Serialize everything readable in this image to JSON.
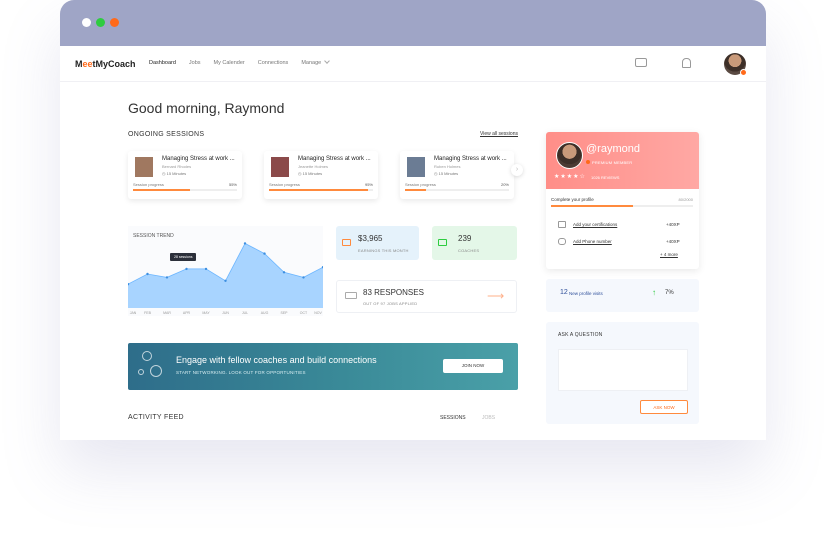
{
  "app": {
    "logo_pre": "M",
    "logo_accent": "ee",
    "logo_post": "tMyCoach"
  },
  "nav": {
    "items": [
      "Dashboard",
      "Jobs",
      "My Calender",
      "Connections",
      "Manage"
    ]
  },
  "greeting": "Good morning, Raymond",
  "sessions": {
    "title": "ONGOING SESSIONS",
    "view_all": "View all sessions",
    "cards": [
      {
        "title": "Managing Stress at work ...",
        "coach": "Bernard Rhodes",
        "time": "15 Minutes",
        "progress_label": "Session progress",
        "progress": "55%",
        "progress_value": 0.55
      },
      {
        "title": "Managing Stress at work ...",
        "coach": "Jeanette Holmes",
        "time": "15 Minutes",
        "progress_label": "Session progress",
        "progress": "95%",
        "progress_value": 0.95
      },
      {
        "title": "Managing Stress at work ...",
        "coach": "Ruben Holmes",
        "time": "15 Minutes",
        "progress_label": "Session progress",
        "progress": "20%",
        "progress_value": 0.2
      }
    ]
  },
  "trend": {
    "title": "SESSION TREND",
    "tooltip": "28 sessions",
    "months": [
      "JAN",
      "FEB",
      "MAR",
      "APR",
      "MAY",
      "JUN",
      "JUL",
      "AUG",
      "SEP",
      "OCT",
      "NOV"
    ],
    "values": [
      14,
      20,
      18,
      23,
      23,
      16,
      38,
      32,
      21,
      18,
      24
    ]
  },
  "stats": {
    "earnings": {
      "value": "$3,965",
      "label": "EARNINGS THIS MONTH"
    },
    "coaches": {
      "value": "239",
      "label": "COACHES"
    },
    "responses": {
      "value": "83 RESPONSES",
      "label": "OUT OF 97 JOBS APPLIED"
    }
  },
  "banner": {
    "title": "Engage with fellow coaches and build connections",
    "subtitle": "START NETWORKING. LOOK OUT FOR OPPORTUNITIES",
    "button": "JOIN NOW"
  },
  "feed": {
    "title": "ACTIVITY FEED",
    "tabs": [
      "SESSIONS",
      "JOBS"
    ]
  },
  "profile": {
    "handle": "@raymond",
    "tier": "PREMIUM MEMBER",
    "stars": "★★★★☆",
    "reviews": "1026 REVIEWS",
    "complete_label": "Complete your profile",
    "complete_value": "80/2000",
    "complete_fraction": 0.58,
    "tasks": [
      {
        "label": "Add your certifications",
        "xp": "+40XP"
      },
      {
        "label": "Add Phone number",
        "xp": "+40XP"
      }
    ],
    "more": "+ 4 more"
  },
  "visits": {
    "count": "12",
    "label": "New profile visits",
    "change": "7%"
  },
  "ask": {
    "title": "ASK A QUESTION",
    "button": "ASK NOW"
  },
  "colors": {
    "accent": "#ff6a1a",
    "progress": "#ff8a3d",
    "titlebar": "#9fa5c6",
    "chart_fill": "#a8d4ff"
  }
}
